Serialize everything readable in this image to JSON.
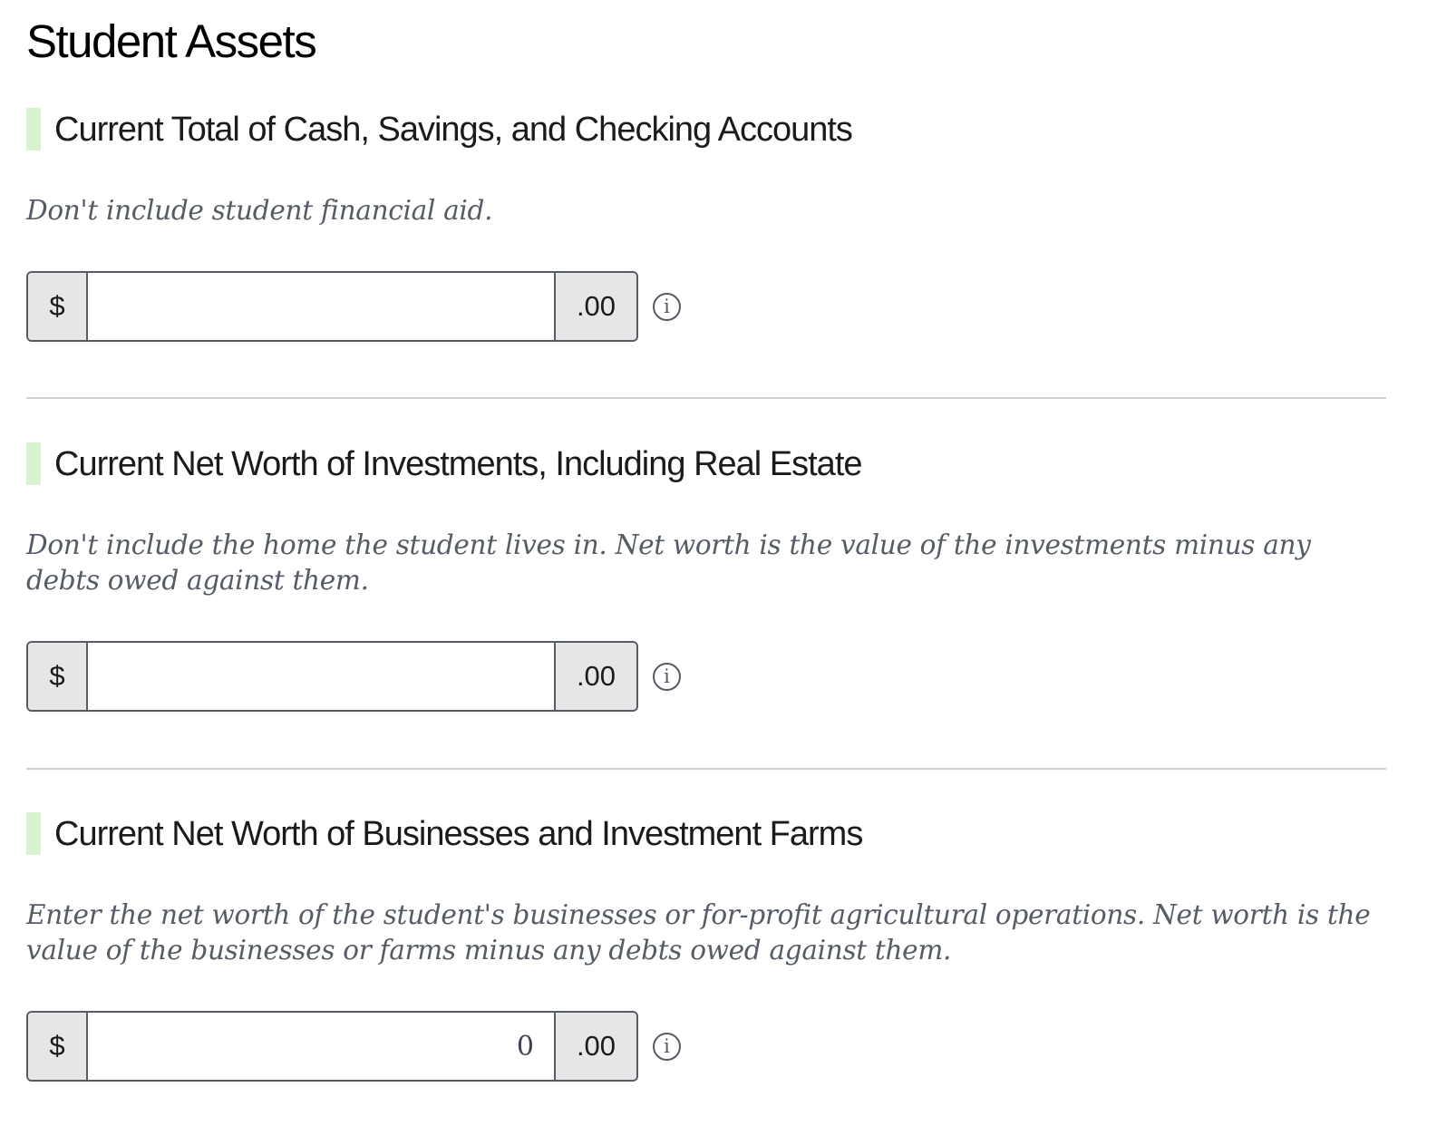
{
  "page": {
    "title": "Student Assets"
  },
  "colors": {
    "accent_bar": "#d9f3cf",
    "border": "#565c65",
    "addon_bg": "#e6e6e6",
    "hint_text": "#565c65",
    "divider": "#cfcfcf"
  },
  "questions": [
    {
      "heading": "Current Total of Cash, Savings, and Checking Accounts",
      "hint": "Don't include student financial aid.",
      "currency_prefix": "$",
      "cents_suffix": ".00",
      "value": "",
      "info_icon": "info-circle-icon"
    },
    {
      "heading": "Current Net Worth of Investments, Including Real Estate",
      "hint": "Don't include the home the student lives in. Net worth is the value of the investments minus any debts owed against them.",
      "currency_prefix": "$",
      "cents_suffix": ".00",
      "value": "",
      "info_icon": "info-circle-icon"
    },
    {
      "heading": "Current Net Worth of Businesses and Investment Farms",
      "hint": "Enter the net worth of the student's businesses or for-profit agricultural operations. Net worth is the value of the businesses or farms minus any debts owed against them.",
      "currency_prefix": "$",
      "cents_suffix": ".00",
      "value": "0",
      "info_icon": "info-circle-icon"
    }
  ]
}
